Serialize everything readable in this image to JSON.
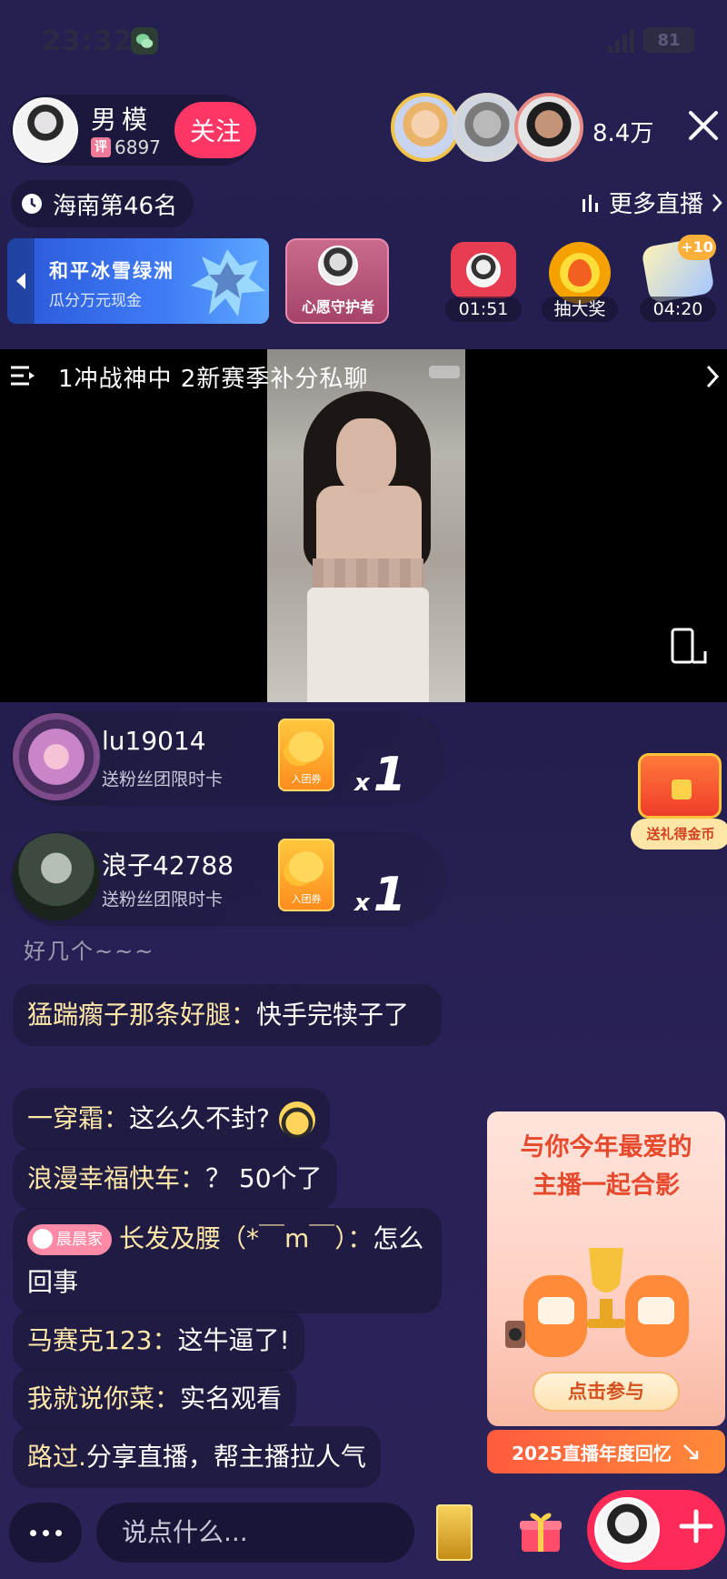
{
  "status_bar": {
    "time": "23:32",
    "battery": "81"
  },
  "anchor": {
    "name": "男模",
    "level_icon": "评",
    "score": "6897",
    "follow_label": "关注"
  },
  "viewers": {
    "count": "8.4万"
  },
  "rank": {
    "label": "海南第46名",
    "more_label": "更多直播"
  },
  "activities": {
    "promo_title": "和平冰雪绿洲",
    "promo_subtitle": "瓜分万元现金",
    "wish_label": "心愿守护者",
    "timer1": "01:51",
    "lottery_label": "抽大奖",
    "timer2": "04:20",
    "timer2_badge": "+10"
  },
  "video": {
    "title": "1冲战神中   2新赛季补分私聊"
  },
  "gifts": [
    {
      "user": "lu19014",
      "desc": "送粉丝团限时卡",
      "card_label": "入团券",
      "x": "x",
      "count": "1"
    },
    {
      "user": "浪子42788",
      "desc": "送粉丝团限时卡",
      "card_label": "入团券",
      "x": "x",
      "count": "1"
    }
  ],
  "treasure": {
    "label": "送礼得金币"
  },
  "chat": {
    "faint": "好几个~~~",
    "messages": [
      {
        "name": "猛踹瘸子那条好腿：",
        "text": "快手完犊子了"
      },
      {
        "name": "一穿霜：",
        "text": "这么久不封?"
      },
      {
        "name": "浪漫幸福快车：",
        "text": "？ 50个了"
      },
      {
        "badge": "晨晨家",
        "name": "长发及腰（*￣m￣）：",
        "text": "怎么回事"
      },
      {
        "name": "马赛克123：",
        "text": "这牛逼了!"
      },
      {
        "name": "我就说你菜：",
        "text": "实名观看"
      },
      {
        "name": "路过.",
        "text": "分享直播，帮主播拉人气"
      }
    ]
  },
  "banner": {
    "line1": "与你今年最爱的",
    "line2": "主播一起合影",
    "button": "点击参与",
    "footer": "2025直播年度回忆"
  },
  "bottom": {
    "input_placeholder": "说点什么..."
  }
}
